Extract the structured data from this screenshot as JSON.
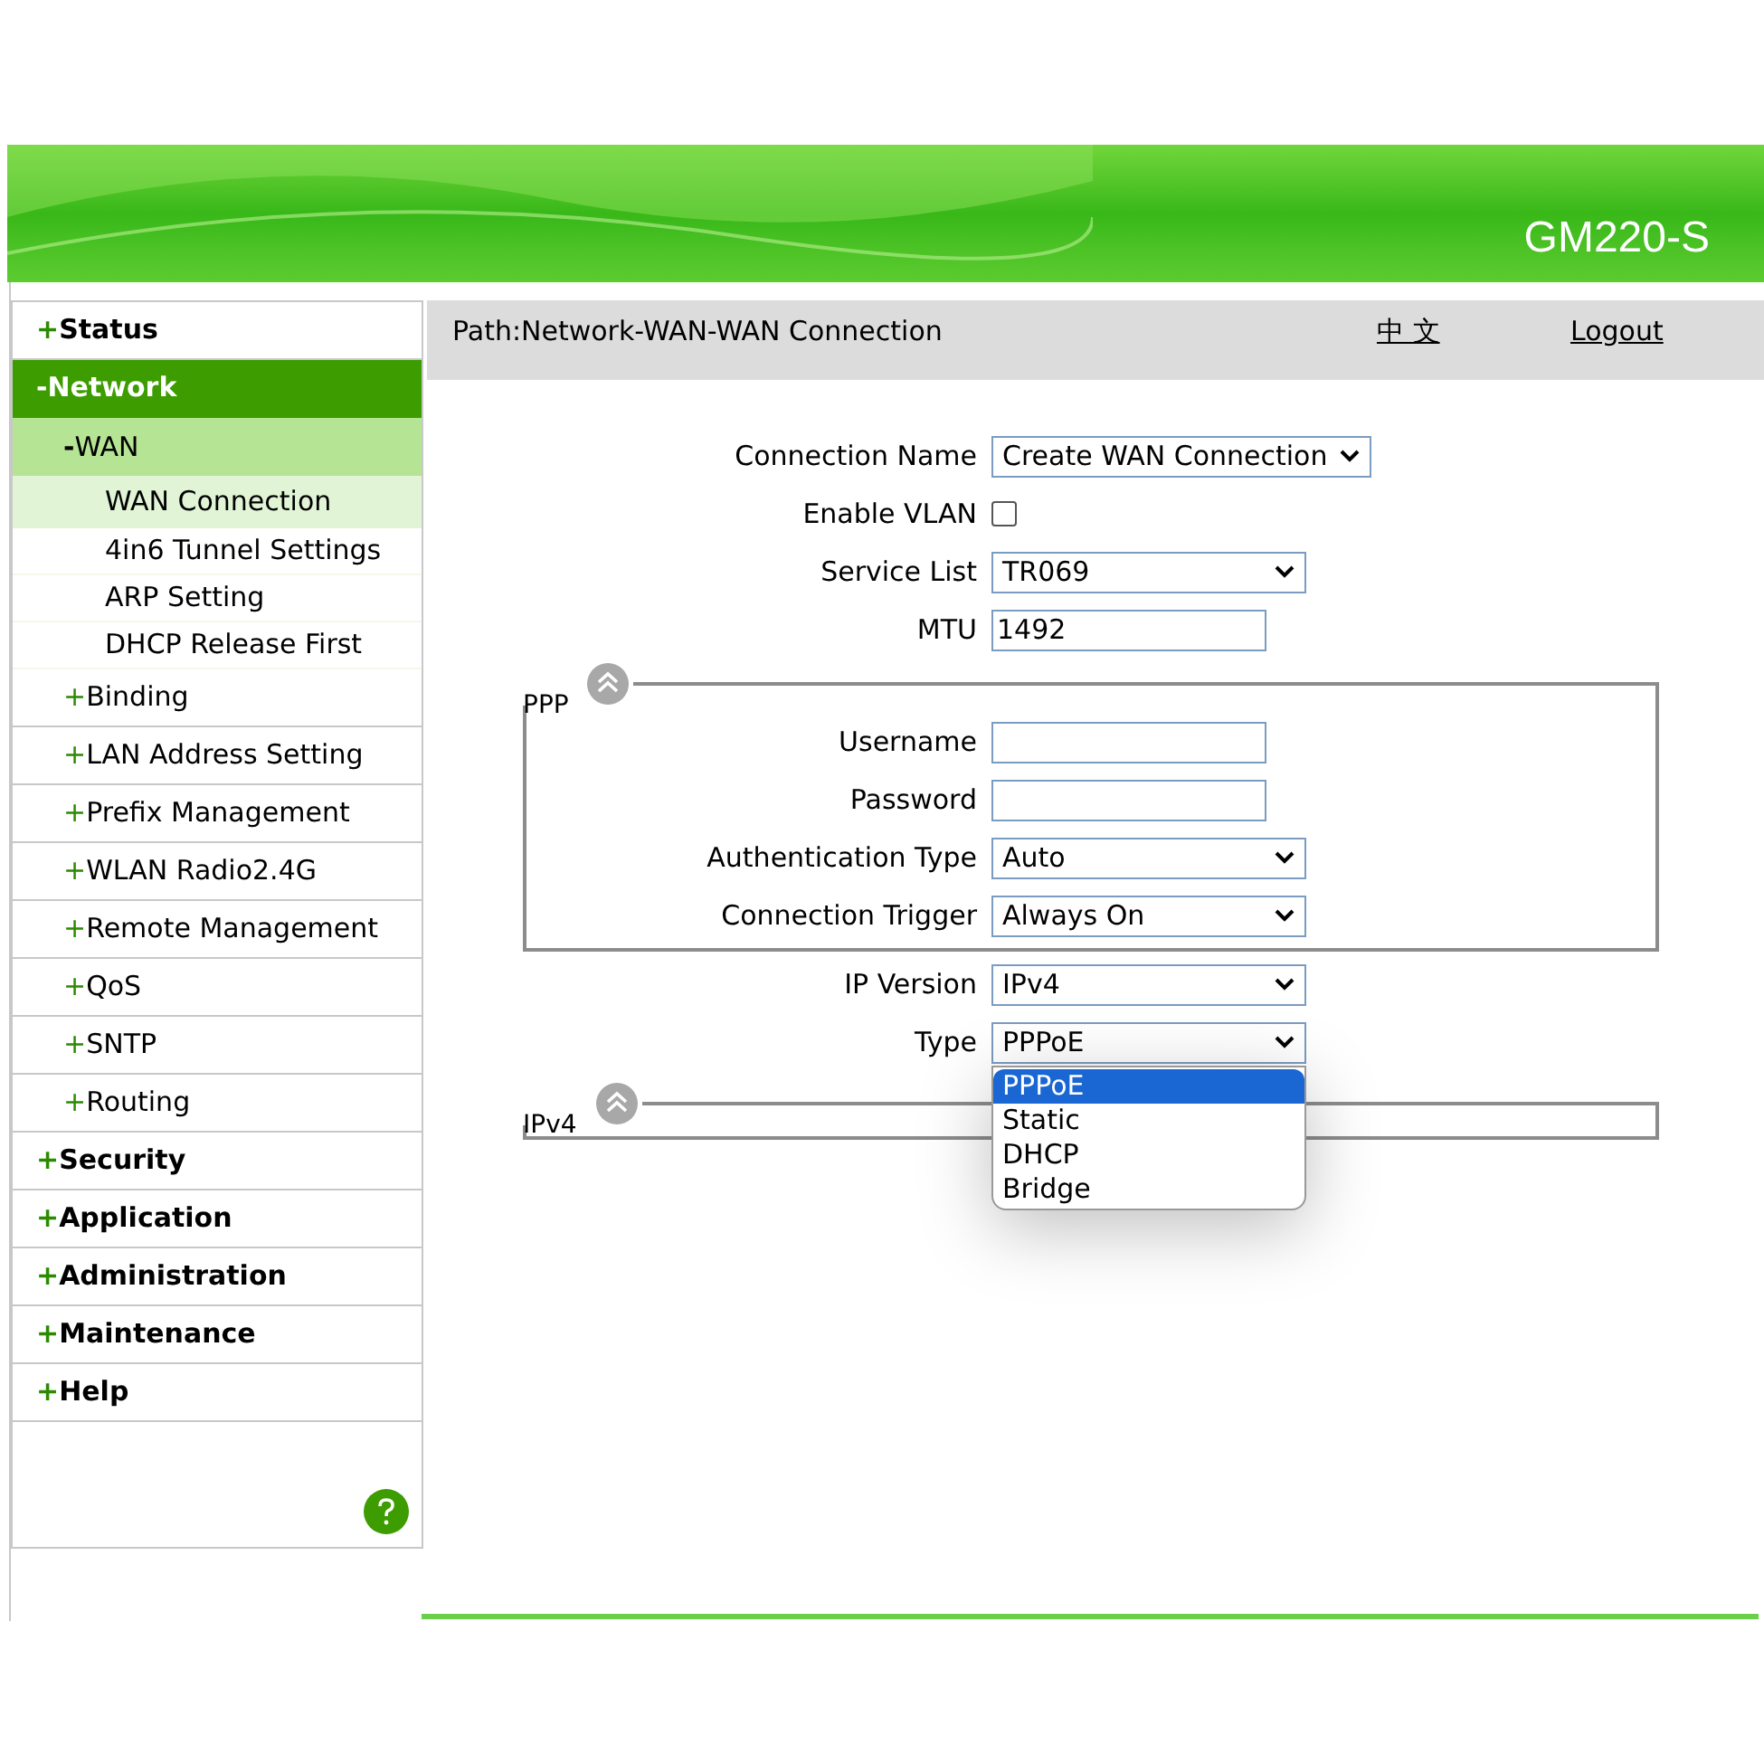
{
  "header": {
    "title": "GM220-S"
  },
  "sidebar": {
    "items": [
      {
        "marker": "+",
        "label": "Status",
        "expanded": false,
        "selected": false
      },
      {
        "marker": "-",
        "label": "Network",
        "expanded": true,
        "selected": true,
        "children": [
          {
            "marker": "-",
            "label": "WAN",
            "expanded": true,
            "selected": true,
            "children": [
              {
                "label": "WAN Connection",
                "selected": true
              },
              {
                "label": "4in6 Tunnel Settings",
                "selected": false
              },
              {
                "label": "ARP Setting",
                "selected": false
              },
              {
                "label": "DHCP Release First",
                "selected": false
              }
            ]
          },
          {
            "marker": "+",
            "label": "Binding",
            "expanded": false,
            "selected": false
          },
          {
            "marker": "+",
            "label": "LAN Address Setting",
            "expanded": false,
            "selected": false
          },
          {
            "marker": "+",
            "label": "Prefix Management",
            "expanded": false,
            "selected": false
          },
          {
            "marker": "+",
            "label": "WLAN Radio2.4G",
            "expanded": false,
            "selected": false
          },
          {
            "marker": "+",
            "label": "Remote Management",
            "expanded": false,
            "selected": false
          },
          {
            "marker": "+",
            "label": "QoS",
            "expanded": false,
            "selected": false
          },
          {
            "marker": "+",
            "label": "SNTP",
            "expanded": false,
            "selected": false
          },
          {
            "marker": "+",
            "label": "Routing",
            "expanded": false,
            "selected": false
          }
        ]
      },
      {
        "marker": "+",
        "label": "Security",
        "expanded": false,
        "selected": false
      },
      {
        "marker": "+",
        "label": "Application",
        "expanded": false,
        "selected": false
      },
      {
        "marker": "+",
        "label": "Administration",
        "expanded": false,
        "selected": false
      },
      {
        "marker": "+",
        "label": "Maintenance",
        "expanded": false,
        "selected": false
      },
      {
        "marker": "+",
        "label": "Help",
        "expanded": false,
        "selected": false
      }
    ]
  },
  "path_bar": {
    "path": "Path:Network-WAN-WAN Connection",
    "language_link": "中 文",
    "logout_link": "Logout"
  },
  "form": {
    "fields": [
      {
        "kind": "select",
        "label": "Connection Name",
        "value": "Create WAN Connection"
      },
      {
        "kind": "checkbox",
        "label": "Enable VLAN",
        "checked": false
      },
      {
        "kind": "select",
        "label": "Service List",
        "value": "TR069"
      },
      {
        "kind": "text",
        "label": "MTU",
        "value": "1492"
      }
    ]
  },
  "ppp_section": {
    "legend": "PPP",
    "fields": [
      {
        "kind": "text",
        "label": "Username"
      },
      {
        "kind": "text",
        "label": "Password"
      },
      {
        "kind": "select",
        "label": "Authentication Type",
        "value": "Auto"
      },
      {
        "kind": "select",
        "label": "Connection Trigger",
        "value": "Always On"
      }
    ]
  },
  "ip_fields": [
    {
      "kind": "select",
      "label": "IP Version",
      "value": "IPv4"
    },
    {
      "kind": "select",
      "label": "Type",
      "value": "PPPoE",
      "open": true,
      "options": [
        {
          "label": "PPPoE",
          "selected": true
        },
        {
          "label": "Static",
          "selected": false
        },
        {
          "label": "DHCP",
          "selected": false
        },
        {
          "label": "Bridge",
          "selected": false
        }
      ]
    }
  ],
  "ipv4_section": {
    "legend": "IPv4"
  }
}
